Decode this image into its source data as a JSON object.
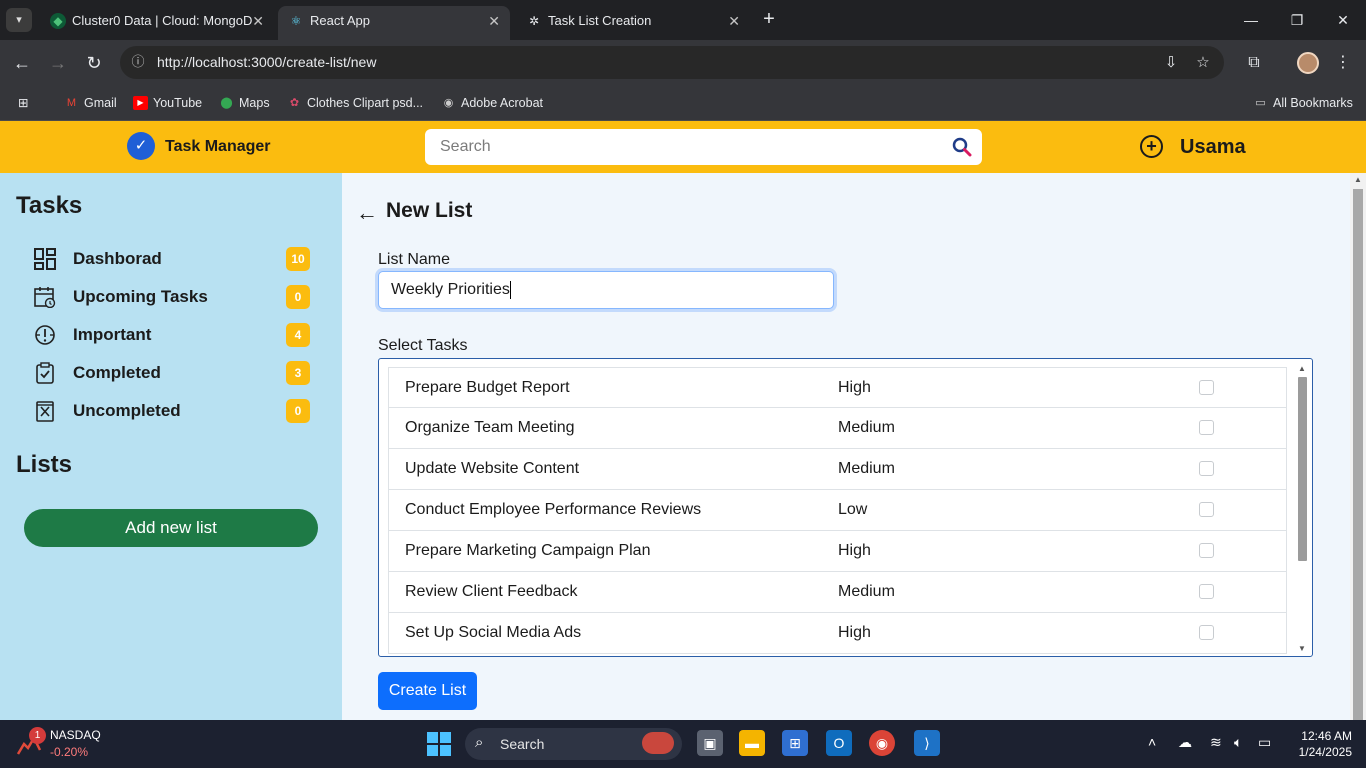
{
  "browser": {
    "tabs": [
      {
        "title": "Cluster0 Data | Cloud: MongoD",
        "active": false
      },
      {
        "title": "React App",
        "active": true
      },
      {
        "title": "Task List Creation",
        "active": false
      }
    ],
    "url": "http://localhost:3000/create-list/new",
    "bookmarks": [
      "Gmail",
      "YouTube",
      "Maps",
      "Clothes Clipart psd...",
      "Adobe Acrobat"
    ],
    "all_bookmarks": "All Bookmarks"
  },
  "app": {
    "brand": "Task Manager",
    "search_placeholder": "Search",
    "user_name": "Usama",
    "accent": "#fbbc0f",
    "sidebar": {
      "tasks_title": "Tasks",
      "items": [
        {
          "label": "Dashborad",
          "count": "10",
          "icon": "dashboard-icon"
        },
        {
          "label": "Upcoming Tasks",
          "count": "0",
          "icon": "calendar-icon"
        },
        {
          "label": "Important",
          "count": "4",
          "icon": "important-icon"
        },
        {
          "label": "Completed",
          "count": "3",
          "icon": "clipboard-check-icon"
        },
        {
          "label": "Uncompleted",
          "count": "0",
          "icon": "uncompleted-icon"
        }
      ],
      "lists_title": "Lists",
      "add_list_label": "Add new list"
    },
    "main": {
      "title": "New List",
      "list_name_label": "List Name",
      "list_name_value": "Weekly Priorities",
      "select_tasks_label": "Select Tasks",
      "tasks": [
        {
          "name": "Prepare Budget Report",
          "priority": "High"
        },
        {
          "name": "Organize Team Meeting",
          "priority": "Medium"
        },
        {
          "name": "Update Website Content",
          "priority": "Medium"
        },
        {
          "name": "Conduct Employee Performance Reviews",
          "priority": "Low"
        },
        {
          "name": "Prepare Marketing Campaign Plan",
          "priority": "High"
        },
        {
          "name": "Review Client Feedback",
          "priority": "Medium"
        },
        {
          "name": "Set Up Social Media Ads",
          "priority": "High"
        }
      ],
      "create_label": "Create List"
    }
  },
  "taskbar": {
    "stock_name": "NASDAQ",
    "stock_change": "-0.20%",
    "stock_badge": "1",
    "search_label": "Search",
    "time": "12:46 AM",
    "date": "1/24/2025"
  }
}
